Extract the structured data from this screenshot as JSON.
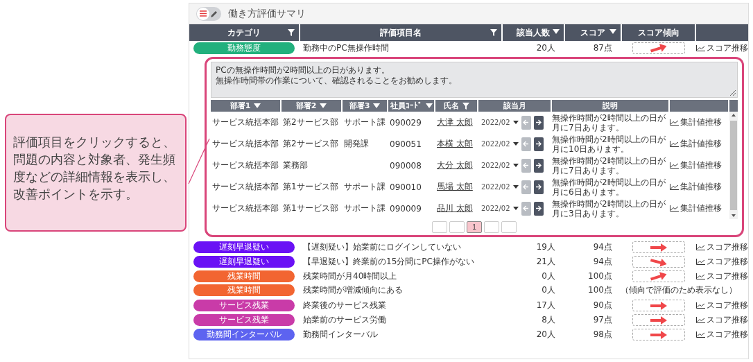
{
  "callout": {
    "text": "評価項目をクリックすると、問題の内容と対象者、発生頻度などの詳細情報を表示し、改善ポイントを示す。"
  },
  "header": {
    "title": "働き方評価サマリ",
    "toggle_on": false
  },
  "table": {
    "columns": [
      {
        "label": "カテゴリ",
        "kind": "filter"
      },
      {
        "label": "評価項目名",
        "kind": "filter"
      },
      {
        "label": "該当人数",
        "kind": "sort"
      },
      {
        "label": "スコア",
        "kind": "sort"
      },
      {
        "label": "スコア傾向",
        "kind": "plain"
      }
    ],
    "rows": [
      {
        "category": "勤務態度",
        "color": "#22b07d",
        "item": "勤務中のPC無操作時間",
        "count": "20人",
        "score": "87点",
        "kind": "rising",
        "link": "スコア推移",
        "detail": {
          "message_lines": [
            "PCの無操作時間が2時間以上の日があります。",
            "無操作時間帯の作業について、確認されることをお勧めします。"
          ],
          "columns": [
            {
              "label": "部署1",
              "kind": "sort"
            },
            {
              "label": "部署2",
              "kind": "sort"
            },
            {
              "label": "部署3",
              "kind": "sort"
            },
            {
              "label": "社員ｺｰﾄﾞ",
              "kind": "sort"
            },
            {
              "label": "氏名",
              "kind": "filter"
            },
            {
              "label": "該当月",
              "kind": "plain"
            },
            {
              "label": "説明",
              "kind": "plain"
            }
          ],
          "rows": [
            {
              "dept1": "サービス統括本部",
              "dept2": "第2サービス部",
              "dept3": "サポート課",
              "code": "090029",
              "name": "大津 太郎",
              "month": "2022/02",
              "prev_enabled": false,
              "next_enabled": true,
              "description": "無操作時間が2時間以上の日が月に7日あります。",
              "link": "集計値推移"
            },
            {
              "dept1": "サービス統括本部",
              "dept2": "第2サービス部",
              "dept3": "開発課",
              "code": "090051",
              "name": "本横 太郎",
              "month": "2022/02",
              "prev_enabled": false,
              "next_enabled": true,
              "description": "無操作時間が2時間以上の日が月に10日あります。",
              "link": "集計値推移"
            },
            {
              "dept1": "サービス統括本部",
              "dept2": "業務部",
              "code": "090008",
              "name": "大分 太郎",
              "month": "2022/02",
              "prev_enabled": false,
              "next_enabled": true,
              "description": "無操作時間が2時間以上の日が月に7日あります。",
              "link": "集計値推移"
            },
            {
              "dept1": "サービス統括本部",
              "dept2": "第1サービス部",
              "dept3": "サポート課",
              "code": "090010",
              "name": "馬場 太郎",
              "month": "2022/02",
              "prev_enabled": false,
              "next_enabled": true,
              "description": "無操作時間が2時間以上の日が月に6日あります。",
              "link": "集計値推移"
            },
            {
              "dept1": "サービス統括本部",
              "dept2": "第1サービス部",
              "dept3": "サポート課",
              "code": "090009",
              "name": "品川 太郎",
              "month": "2022/02",
              "prev_enabled": false,
              "next_enabled": true,
              "description": "無操作時間が2時間以上の日が月に3日あります。",
              "link": "集計値推移"
            }
          ],
          "pages": [
            {
              "selected": false
            },
            {
              "selected": false
            },
            {
              "label": "1",
              "selected": true
            },
            {
              "selected": false
            },
            {
              "selected": false
            }
          ]
        }
      },
      {
        "category": "遅刻早退疑い",
        "color": "#6a11f5",
        "item": "【遅刻疑い】始業前にログインしていない",
        "count": "19人",
        "score": "94点",
        "kind": "level",
        "link": "スコア推移"
      },
      {
        "category": "遅刻早退疑い",
        "color": "#6a11f5",
        "item": "【早退疑い】終業前の15分間にPC操作がない",
        "count": "21人",
        "score": "94点",
        "kind": "falling",
        "link": "スコア推移"
      },
      {
        "category": "残業時間",
        "color": "#f26531",
        "item": "残業時間が月40時間以上",
        "count": "0人",
        "score": "100点",
        "kind": "rising",
        "link": "スコア推移"
      },
      {
        "category": "残業時間",
        "color": "#f26531",
        "item": "残業時間が増減傾向にある",
        "count": "0人",
        "score": "100点",
        "kind": "note",
        "note": "（傾向で評価のため表示なし）"
      },
      {
        "category": "サービス残業",
        "color": "#c93ba8",
        "item": "終業後のサービス残業",
        "count": "17人",
        "score": "90点",
        "kind": "level",
        "link": "スコア推移"
      },
      {
        "category": "サービス残業",
        "color": "#c93ba8",
        "item": "始業前のサービス労働",
        "count": "8人",
        "score": "97点",
        "kind": "level",
        "link": "スコア推移"
      },
      {
        "category": "勤務間インターバル",
        "color": "#5d63f0",
        "item": "勤務間インターバル",
        "count": "20人",
        "score": "98点",
        "kind": "level",
        "link": "スコア推移"
      }
    ]
  }
}
